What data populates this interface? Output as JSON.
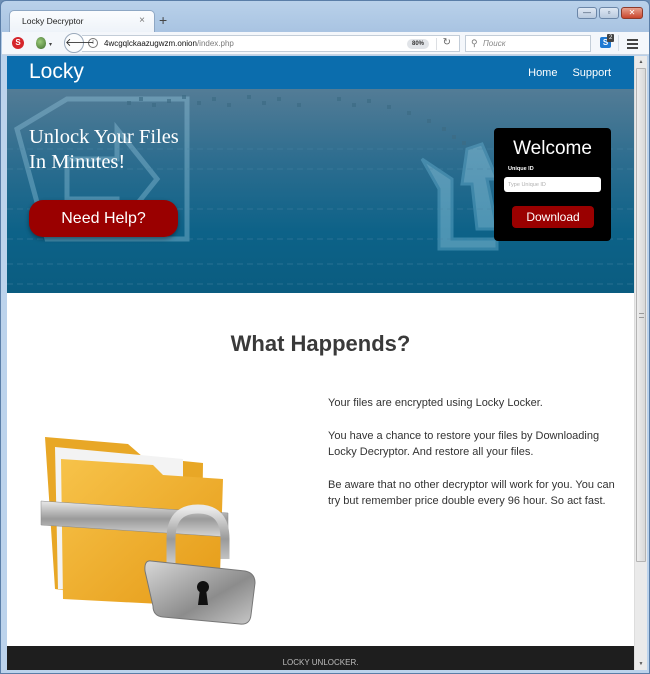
{
  "browser": {
    "tab": {
      "title": "Locky Decryptor",
      "close_glyph": "×"
    },
    "new_tab_glyph": "+",
    "window_controls": {
      "minimize": "—",
      "maximize": "▫",
      "close": "✕"
    },
    "extensions": {
      "noscript": "S",
      "onion_arrow": "▾"
    },
    "back_glyph": "🡐",
    "info_glyph": "i",
    "url": {
      "domain": "4wcgqlckaazugwzm.onion",
      "path": "/index.php"
    },
    "zoom_level": "80%",
    "reload_glyph": "↻",
    "search": {
      "placeholder": "Поиск",
      "glyph": "⚲"
    },
    "skype": {
      "letter": "S",
      "badge": "2"
    }
  },
  "site": {
    "brand": "Locky",
    "nav": [
      {
        "label": "Home"
      },
      {
        "label": "Support"
      }
    ],
    "hero": {
      "title_line1": "Unlock Your Files",
      "title_line2": "In Minutes!",
      "help_button": "Need Help?"
    },
    "welcome": {
      "title": "Welcome",
      "uid_label": "Unique ID",
      "uid_placeholder": "Type Unique ID",
      "uid_value": "",
      "download_button": "Download"
    },
    "section": {
      "title": "What Happends?",
      "paragraphs": [
        "Your files are encrypted using Locky Locker.",
        "You have a chance to restore your files by Downloading Locky Decryptor. And restore all your files.",
        "Be aware that no other decryptor will work for you. You can try but remember price double every 96 hour. So act fast."
      ],
      "illustration": "locked-folder"
    },
    "footer": "LOCKY UNLOCKER."
  },
  "scrollbar": {
    "up_glyph": "▲",
    "down_glyph": "▼",
    "position": 0.0
  },
  "colors": {
    "header_blue": "#0b6dad",
    "button_red": "#9a0000",
    "footer_dark": "#1e1e1e",
    "heading_gray": "#3a3a3a"
  }
}
